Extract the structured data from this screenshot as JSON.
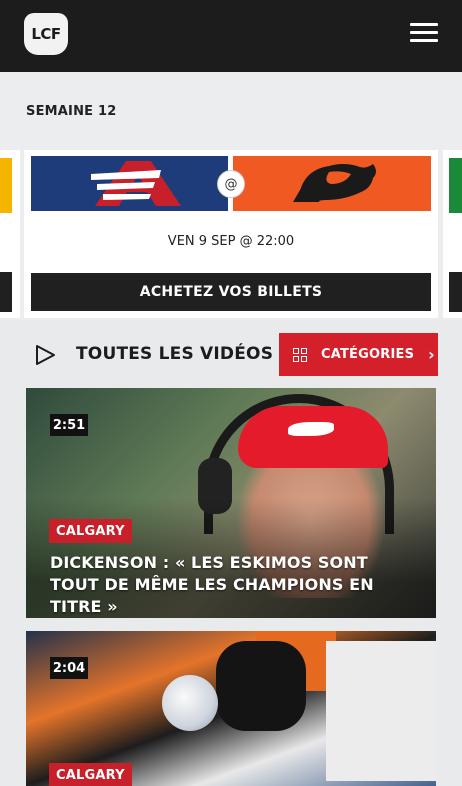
{
  "header": {
    "logo_text": "LCF",
    "menu_icon": "hamburger-menu-icon"
  },
  "schedule": {
    "week_label": "SEMAINE 12",
    "game": {
      "home_team": "MTL",
      "away_team": "BC",
      "home_color": "#1e3b7a",
      "away_color": "#f05a22",
      "at_symbol": "@",
      "date_time": "VEN 9 SEP @ 22:00",
      "tickets_label": "ACHETEZ VOS BILLETS"
    }
  },
  "videos": {
    "section_title": "TOUTES LES VIDÉOS",
    "categories_label": "CATÉGORIES",
    "items": [
      {
        "duration": "2:51",
        "team": "CALGARY",
        "title": "DICKENSON : « LES ESKIMOS SONT TOUT DE MÊME LES CHAMPIONS EN TITRE »"
      },
      {
        "duration": "2:04",
        "team": "CALGARY",
        "title": ""
      }
    ]
  },
  "colors": {
    "accent_red": "#d3202a",
    "dark": "#1c1c1c"
  }
}
